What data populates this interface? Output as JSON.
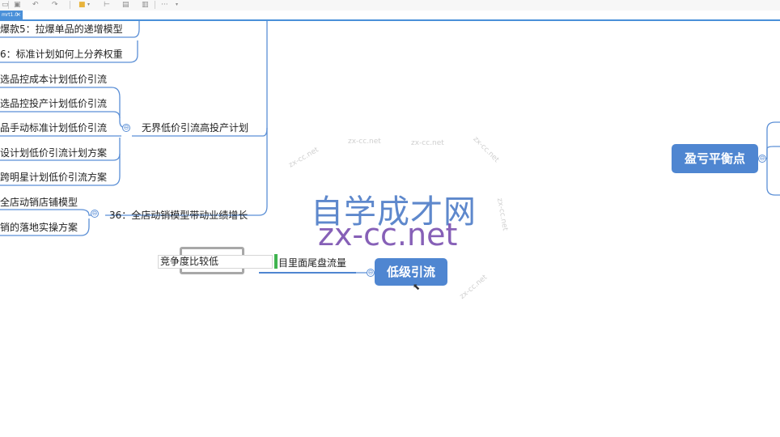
{
  "toolbar": {
    "icons": [
      "save-icon",
      "undo-icon",
      "redo-icon",
      "folder-icon",
      "branch-icon",
      "image-icon",
      "note-icon",
      "more-icon"
    ],
    "more_label": "···"
  },
  "tab": {
    "label": "mrt1.0",
    "close": "×"
  },
  "nodes": {
    "n1": "爆款5：拉爆单品的递增模型",
    "n2": "6：标准计划如何上分养权重",
    "n3": "选品控成本计划低价引流",
    "n4": "选品控投产计划低价引流",
    "n5": "品手动标准计划低价引流",
    "n6": "设计划低价引流计划方案",
    "n7": "跨明星计划低价引流方案",
    "n8": "无界低价引流高投产计划",
    "n9": "全店动销店铺模型",
    "n10": "销的落地实操方案",
    "n11": "36：全店动销模型带动业绩增长",
    "n12": "目里面尾盘流量"
  },
  "edit": {
    "value": "竞争度比较低"
  },
  "topics": {
    "low": "低级引流",
    "breakeven": "盈亏平衡点"
  },
  "collapse_symbol": "⊖",
  "watermark": {
    "cn": "自学成才网",
    "en": "zx-cc.net",
    "faint": "zx-cc.net"
  },
  "colors": {
    "accent": "#4f86d1",
    "line": "#5b8fd6"
  }
}
